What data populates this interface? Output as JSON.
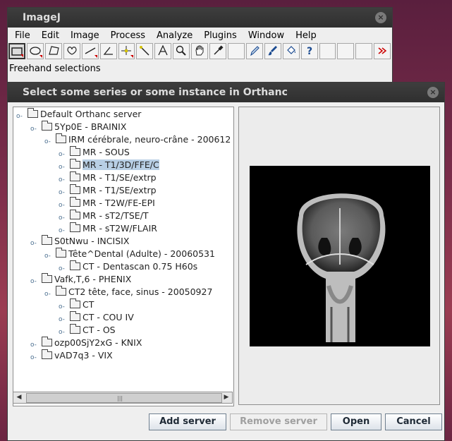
{
  "imagej": {
    "title": "ImageJ",
    "close_icon": "×",
    "menu": [
      "File",
      "Edit",
      "Image",
      "Process",
      "Analyze",
      "Plugins",
      "Window",
      "Help"
    ],
    "tools": [
      "rect-icon",
      "oval-icon",
      "polygon-icon",
      "freehand-icon",
      "line-icon",
      "angle-icon",
      "point-icon",
      "wand-icon",
      "text-icon",
      "magnifier-icon",
      "hand-icon",
      "dropper-icon",
      "blank-icon",
      "pencil-icon",
      "brush-icon",
      "flood-icon",
      "help-icon",
      "blank-icon",
      "blank-icon",
      "blank-icon",
      "more-icon"
    ],
    "status": "Freehand selections"
  },
  "dialog": {
    "title": "Select some series or some instance in Orthanc",
    "close_icon": "×",
    "tree": [
      {
        "label": "Default Orthanc server"
      },
      {
        "label": "5Yp0E - BRAINIX"
      },
      {
        "label": "IRM cérébrale, neuro-crâne - 200612"
      },
      {
        "label": "MR - SOUS"
      },
      {
        "label": "MR - T1/3D/FFE/C"
      },
      {
        "label": "MR - T1/SE/extrp"
      },
      {
        "label": "MR - T1/SE/extrp"
      },
      {
        "label": "MR - T2W/FE-EPI"
      },
      {
        "label": "MR - sT2/TSE/T"
      },
      {
        "label": "MR - sT2W/FLAIR"
      },
      {
        "label": "S0tNwu - INCISIX"
      },
      {
        "label": "Tête^Dental (Adulte) - 20060531"
      },
      {
        "label": "CT - Dentascan  0.75  H60s"
      },
      {
        "label": "Vafk,T,6 - PHENIX"
      },
      {
        "label": "CT2 tête, face, sinus - 20050927"
      },
      {
        "label": "CT"
      },
      {
        "label": "CT - COU IV"
      },
      {
        "label": "CT - OS"
      },
      {
        "label": "ozp00SjY2xG - KNIX"
      },
      {
        "label": "vAD7q3 - VIX"
      }
    ],
    "buttons": {
      "add": "Add server",
      "remove": "Remove server",
      "open": "Open",
      "cancel": "Cancel"
    }
  }
}
